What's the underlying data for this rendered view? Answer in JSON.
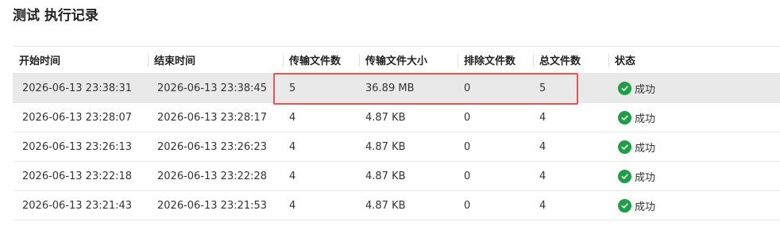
{
  "title": "测试 执行记录",
  "colors": {
    "success": "#1e9e46",
    "highlight_border": "#e45757",
    "highlight_row": "#e9e9e9"
  },
  "table": {
    "headers": [
      "开始时间",
      "结束时间",
      "传输文件数",
      "传输文件大小",
      "排除文件数",
      "总文件数",
      "状态"
    ],
    "rows": [
      {
        "start": "2026-06-13 23:38:31",
        "end": "2026-06-13 23:38:45",
        "transferred": "5",
        "size": "36.89 MB",
        "excluded": "0",
        "total": "5",
        "status": "成功",
        "status_icon": "check-circle-icon"
      },
      {
        "start": "2026-06-13 23:28:07",
        "end": "2026-06-13 23:28:17",
        "transferred": "4",
        "size": "4.87 KB",
        "excluded": "0",
        "total": "4",
        "status": "成功",
        "status_icon": "check-circle-icon"
      },
      {
        "start": "2026-06-13 23:26:13",
        "end": "2026-06-13 23:26:23",
        "transferred": "4",
        "size": "4.87 KB",
        "excluded": "0",
        "total": "4",
        "status": "成功",
        "status_icon": "check-circle-icon"
      },
      {
        "start": "2026-06-13 23:22:18",
        "end": "2026-06-13 23:22:28",
        "transferred": "4",
        "size": "4.87 KB",
        "excluded": "0",
        "total": "4",
        "status": "成功",
        "status_icon": "check-circle-icon"
      },
      {
        "start": "2026-06-13 23:21:43",
        "end": "2026-06-13 23:21:53",
        "transferred": "4",
        "size": "4.87 KB",
        "excluded": "0",
        "total": "4",
        "status": "成功",
        "status_icon": "check-circle-icon"
      }
    ]
  }
}
